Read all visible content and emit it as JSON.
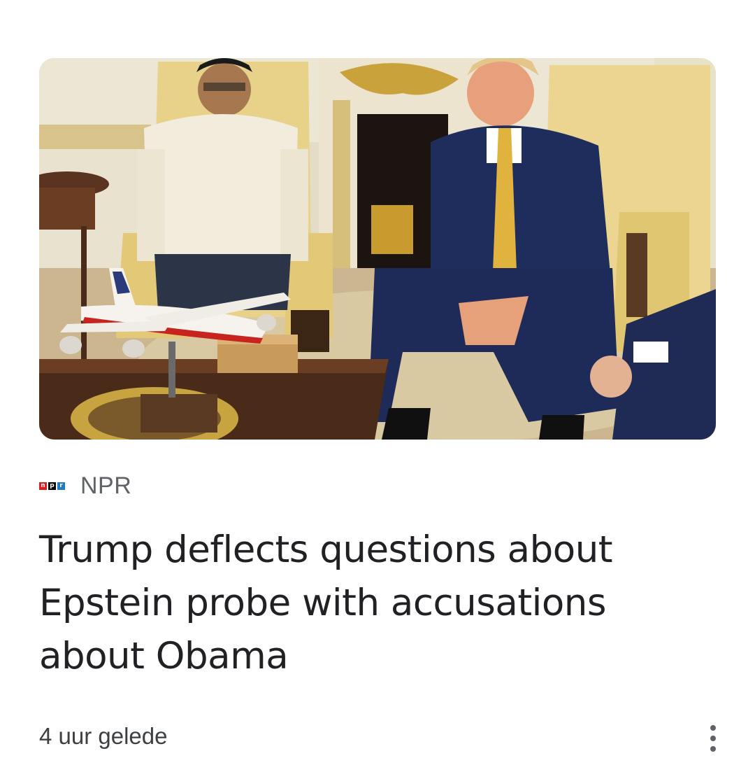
{
  "article": {
    "image_alt": "Trump and Marcos seated in the Oval Office with a model airplane",
    "source": {
      "logo_letters": [
        "n",
        "p",
        "r"
      ],
      "logo_colors": [
        "#d62021",
        "#000000",
        "#237bbd"
      ],
      "name": "NPR"
    },
    "headline": "Trump deflects questions about Epstein probe with accusations about Obama",
    "timestamp": "4 uur gelede",
    "more_icon": "more-vert-icon"
  }
}
